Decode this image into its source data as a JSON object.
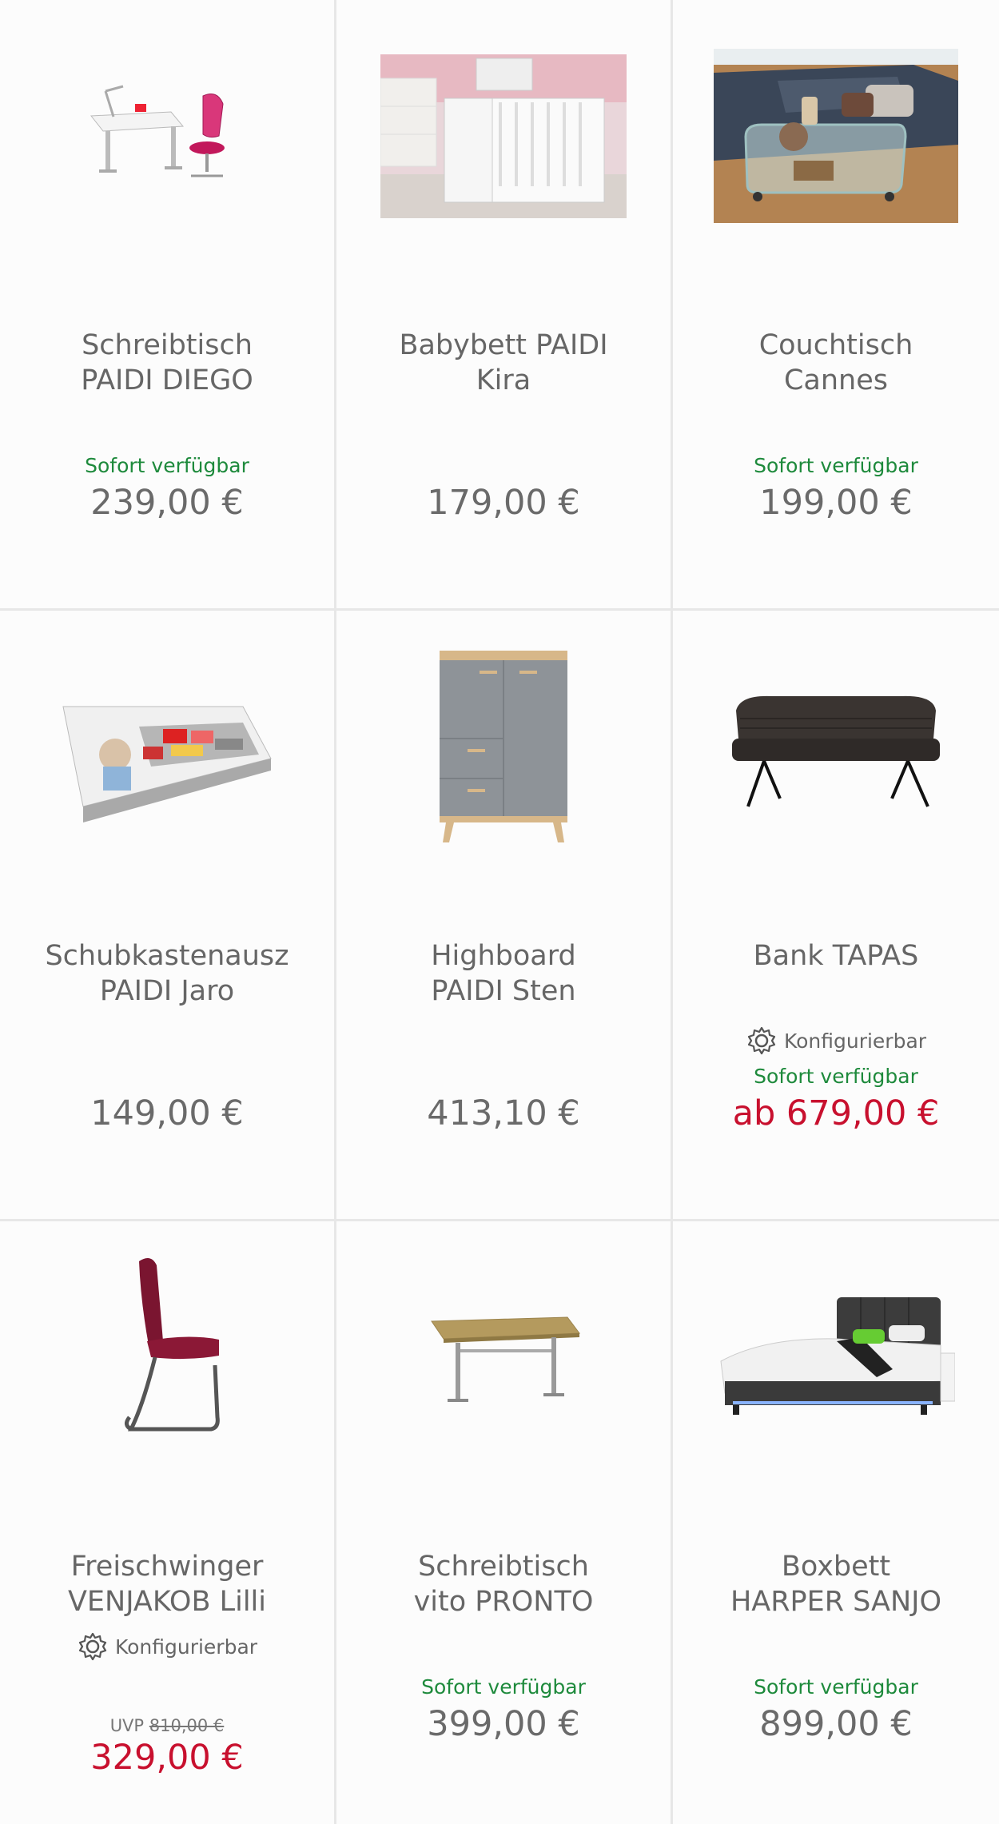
{
  "products": [
    {
      "title_line1": "Schreibtisch",
      "title_line2": "PAIDI DIEGO",
      "availability": "Sofort verfügbar",
      "price": "239,00 €",
      "image_icon": "desk-with-chair-image"
    },
    {
      "title_line1": "Babybett PAIDI",
      "title_line2": "Kira",
      "availability": "",
      "price": "179,00 €",
      "image_icon": "baby-crib-image"
    },
    {
      "title_line1": "Couchtisch",
      "title_line2": "Cannes",
      "availability": "Sofort verfügbar",
      "price": "199,00 €",
      "image_icon": "glass-coffee-table-image"
    },
    {
      "title_line1": "Schubkastenausz",
      "title_line2": "PAIDI Jaro",
      "availability": "",
      "price": "149,00 €",
      "image_icon": "drawer-organizer-image"
    },
    {
      "title_line1": "Highboard",
      "title_line2": "PAIDI Sten",
      "availability": "",
      "price": "413,10 €",
      "image_icon": "grey-highboard-image"
    },
    {
      "title_line1": "Bank TAPAS",
      "title_line2": "",
      "configurable": "Konfigurierbar",
      "availability": "Sofort verfügbar",
      "price": "ab 679,00 €",
      "image_icon": "upholstered-bench-image"
    },
    {
      "title_line1": "Freischwinger",
      "title_line2": "VENJAKOB Lilli",
      "configurable": "Konfigurierbar",
      "uvp_label": "UVP",
      "uvp_value": "810,00 €",
      "price": "329,00 €",
      "image_icon": "cantilever-chair-image"
    },
    {
      "title_line1": "Schreibtisch",
      "title_line2": "vito PRONTO",
      "availability": "Sofort verfügbar",
      "price": "399,00 €",
      "image_icon": "standing-desk-image"
    },
    {
      "title_line1": "Boxbett",
      "title_line2": "HARPER SANJO",
      "availability": "Sofort verfügbar",
      "price": "899,00 €",
      "image_icon": "boxspring-bed-image"
    }
  ],
  "colors": {
    "availability_green": "#1e8a3c",
    "sale_red": "#c8102e",
    "price_grey": "#6a6a6a",
    "divider": "#e7e7e7"
  }
}
